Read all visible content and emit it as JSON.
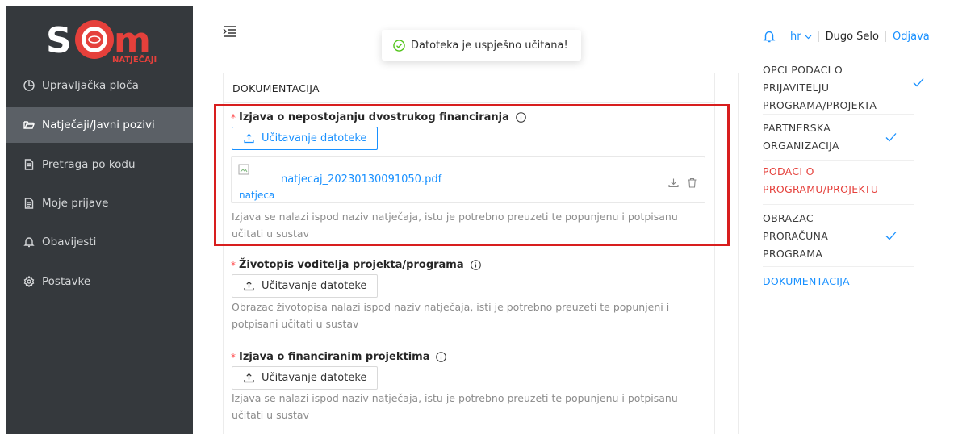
{
  "logo": {
    "brand": "SOM",
    "sub": "NATJEČAJI"
  },
  "sidebar": {
    "items": [
      {
        "label": "Upravljačka ploča",
        "icon": "dashboard-icon"
      },
      {
        "label": "Natječaji/Javni pozivi",
        "icon": "folder-open-icon",
        "active": true
      },
      {
        "label": "Pretraga po kodu",
        "icon": "file-search-icon"
      },
      {
        "label": "Moje prijave",
        "icon": "file-text-icon"
      },
      {
        "label": "Obavijesti",
        "icon": "bell-icon"
      },
      {
        "label": "Postavke",
        "icon": "gear-icon"
      }
    ]
  },
  "header": {
    "toast": "Datoteka je uspješno učitana!",
    "language": "hr",
    "city": "Dugo Selo",
    "logout": "Odjava"
  },
  "main": {
    "section_title": "DOKUMENTACIJA",
    "upload_label": "Učitavanje datoteke",
    "fields": [
      {
        "label": "Izjava o nepostojanju dvostrukog financiranja",
        "file_name": "natjecaj_20230130091050.pdf",
        "thumb_alt": "natjecaj_20230130091050.pdf",
        "help_1": "Izjava se nalazi ispod naziv natječaja, istu je potrebno preuzeti te popunjenu i potpisanu",
        "help_2": "učitati u sustav"
      },
      {
        "label": "Životopis voditelja projekta/programa",
        "help_1": "Obrazac životopisa nalazi ispod naziv natječaja, isti je potrebno preuzeti te popunjeni i",
        "help_2": "potpisani učitati u sustav"
      },
      {
        "label": "Izjava o financiranim projektima",
        "help_1": "Izjava se nalazi ispod naziv natječaja, istu je potrebno preuzeti te popunjenu i potpisanu",
        "help_2": "učitati u sustav"
      }
    ]
  },
  "steps": [
    {
      "lines": [
        "OPĆI PODACI O",
        "PRIJAVITELJU",
        "PROGRAMA/PROJEKTA"
      ],
      "done": true
    },
    {
      "lines": [
        "PARTNERSKA",
        "ORGANIZACIJA"
      ],
      "done": true
    },
    {
      "lines": [
        "PODACI O",
        "PROGRAMU/PROJEKTU"
      ],
      "done": false,
      "state": "error"
    },
    {
      "lines": [
        "OBRAZAC",
        "PRORAČUNA",
        "PROGRAMA"
      ],
      "done": true
    },
    {
      "lines": [
        "DOKUMENTACIJA"
      ],
      "done": false,
      "state": "current"
    }
  ],
  "colors": {
    "accent": "#1890ff",
    "error": "#e5403b",
    "sidebar": "#35393d",
    "highlight": "#d81e1e"
  }
}
